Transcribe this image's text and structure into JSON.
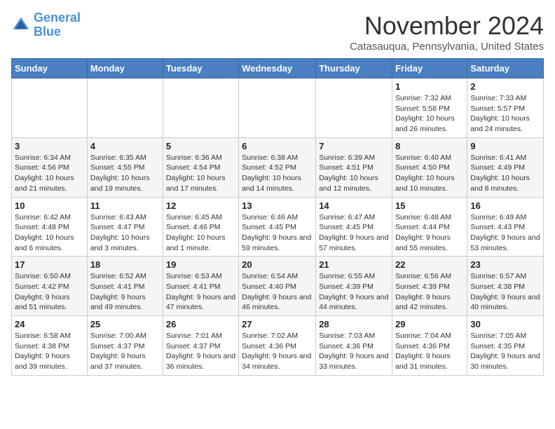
{
  "logo": {
    "line1": "General",
    "line2": "Blue"
  },
  "title": "November 2024",
  "subtitle": "Catasauqua, Pennsylvania, United States",
  "days_of_week": [
    "Sunday",
    "Monday",
    "Tuesday",
    "Wednesday",
    "Thursday",
    "Friday",
    "Saturday"
  ],
  "weeks": [
    [
      {
        "day": "",
        "info": ""
      },
      {
        "day": "",
        "info": ""
      },
      {
        "day": "",
        "info": ""
      },
      {
        "day": "",
        "info": ""
      },
      {
        "day": "",
        "info": ""
      },
      {
        "day": "1",
        "info": "Sunrise: 7:32 AM\nSunset: 5:58 PM\nDaylight: 10 hours and 26 minutes."
      },
      {
        "day": "2",
        "info": "Sunrise: 7:33 AM\nSunset: 5:57 PM\nDaylight: 10 hours and 24 minutes."
      }
    ],
    [
      {
        "day": "3",
        "info": "Sunrise: 6:34 AM\nSunset: 4:56 PM\nDaylight: 10 hours and 21 minutes."
      },
      {
        "day": "4",
        "info": "Sunrise: 6:35 AM\nSunset: 4:55 PM\nDaylight: 10 hours and 19 minutes."
      },
      {
        "day": "5",
        "info": "Sunrise: 6:36 AM\nSunset: 4:54 PM\nDaylight: 10 hours and 17 minutes."
      },
      {
        "day": "6",
        "info": "Sunrise: 6:38 AM\nSunset: 4:52 PM\nDaylight: 10 hours and 14 minutes."
      },
      {
        "day": "7",
        "info": "Sunrise: 6:39 AM\nSunset: 4:51 PM\nDaylight: 10 hours and 12 minutes."
      },
      {
        "day": "8",
        "info": "Sunrise: 6:40 AM\nSunset: 4:50 PM\nDaylight: 10 hours and 10 minutes."
      },
      {
        "day": "9",
        "info": "Sunrise: 6:41 AM\nSunset: 4:49 PM\nDaylight: 10 hours and 8 minutes."
      }
    ],
    [
      {
        "day": "10",
        "info": "Sunrise: 6:42 AM\nSunset: 4:48 PM\nDaylight: 10 hours and 6 minutes."
      },
      {
        "day": "11",
        "info": "Sunrise: 6:43 AM\nSunset: 4:47 PM\nDaylight: 10 hours and 3 minutes."
      },
      {
        "day": "12",
        "info": "Sunrise: 6:45 AM\nSunset: 4:46 PM\nDaylight: 10 hours and 1 minute."
      },
      {
        "day": "13",
        "info": "Sunrise: 6:46 AM\nSunset: 4:45 PM\nDaylight: 9 hours and 59 minutes."
      },
      {
        "day": "14",
        "info": "Sunrise: 6:47 AM\nSunset: 4:45 PM\nDaylight: 9 hours and 57 minutes."
      },
      {
        "day": "15",
        "info": "Sunrise: 6:48 AM\nSunset: 4:44 PM\nDaylight: 9 hours and 55 minutes."
      },
      {
        "day": "16",
        "info": "Sunrise: 6:49 AM\nSunset: 4:43 PM\nDaylight: 9 hours and 53 minutes."
      }
    ],
    [
      {
        "day": "17",
        "info": "Sunrise: 6:50 AM\nSunset: 4:42 PM\nDaylight: 9 hours and 51 minutes."
      },
      {
        "day": "18",
        "info": "Sunrise: 6:52 AM\nSunset: 4:41 PM\nDaylight: 9 hours and 49 minutes."
      },
      {
        "day": "19",
        "info": "Sunrise: 6:53 AM\nSunset: 4:41 PM\nDaylight: 9 hours and 47 minutes."
      },
      {
        "day": "20",
        "info": "Sunrise: 6:54 AM\nSunset: 4:40 PM\nDaylight: 9 hours and 46 minutes."
      },
      {
        "day": "21",
        "info": "Sunrise: 6:55 AM\nSunset: 4:39 PM\nDaylight: 9 hours and 44 minutes."
      },
      {
        "day": "22",
        "info": "Sunrise: 6:56 AM\nSunset: 4:39 PM\nDaylight: 9 hours and 42 minutes."
      },
      {
        "day": "23",
        "info": "Sunrise: 6:57 AM\nSunset: 4:38 PM\nDaylight: 9 hours and 40 minutes."
      }
    ],
    [
      {
        "day": "24",
        "info": "Sunrise: 6:58 AM\nSunset: 4:38 PM\nDaylight: 9 hours and 39 minutes."
      },
      {
        "day": "25",
        "info": "Sunrise: 7:00 AM\nSunset: 4:37 PM\nDaylight: 9 hours and 37 minutes."
      },
      {
        "day": "26",
        "info": "Sunrise: 7:01 AM\nSunset: 4:37 PM\nDaylight: 9 hours and 36 minutes."
      },
      {
        "day": "27",
        "info": "Sunrise: 7:02 AM\nSunset: 4:36 PM\nDaylight: 9 hours and 34 minutes."
      },
      {
        "day": "28",
        "info": "Sunrise: 7:03 AM\nSunset: 4:36 PM\nDaylight: 9 hours and 33 minutes."
      },
      {
        "day": "29",
        "info": "Sunrise: 7:04 AM\nSunset: 4:36 PM\nDaylight: 9 hours and 31 minutes."
      },
      {
        "day": "30",
        "info": "Sunrise: 7:05 AM\nSunset: 4:35 PM\nDaylight: 9 hours and 30 minutes."
      }
    ]
  ]
}
